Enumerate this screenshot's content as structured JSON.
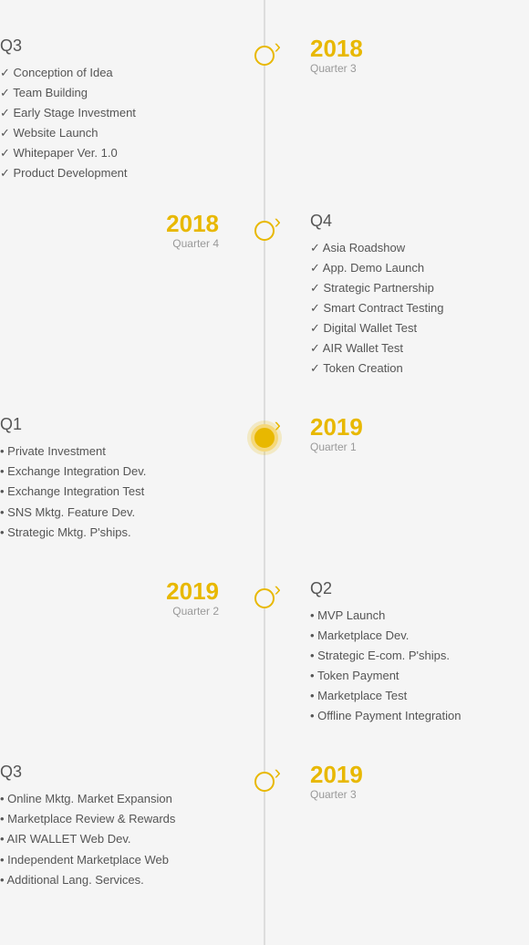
{
  "timeline": {
    "blocks": [
      {
        "id": "q3-2018",
        "side": "left-text",
        "active": false,
        "left": {
          "quarter_title": "Q3",
          "items": [
            "Conception of Idea",
            "Team Building",
            "Early Stage Investment",
            "Website Launch",
            "Whitepaper Ver. 1.0",
            "Product Development"
          ],
          "item_type": "check"
        },
        "right": {
          "year": "2018",
          "quarter": "Quarter 3"
        }
      },
      {
        "id": "q4-2018",
        "side": "right-text",
        "active": false,
        "left": {
          "year": "2018",
          "quarter": "Quarter 4"
        },
        "right": {
          "quarter_title": "Q4",
          "items": [
            "Asia Roadshow",
            "App. Demo Launch",
            "Strategic Partnership",
            "Smart Contract Testing",
            "Digital Wallet Test",
            "AIR Wallet Test",
            "Token Creation"
          ],
          "item_type": "check"
        }
      },
      {
        "id": "q1-2019",
        "side": "left-text",
        "active": true,
        "left": {
          "quarter_title": "Q1",
          "items": [
            "Private Investment",
            "Exchange Integration Dev.",
            "Exchange Integration Test",
            "SNS Mktg. Feature Dev.",
            "Strategic Mktg. P'ships."
          ],
          "item_type": "bullet"
        },
        "right": {
          "year": "2019",
          "quarter": "Quarter 1"
        }
      },
      {
        "id": "q2-2019",
        "side": "right-text",
        "active": false,
        "left": {
          "year": "2019",
          "quarter": "Quarter 2"
        },
        "right": {
          "quarter_title": "Q2",
          "items": [
            "MVP Launch",
            "Marketplace Dev.",
            "Strategic E-com. P'ships.",
            "Token Payment",
            "Marketplace Test",
            "Offline Payment Integration"
          ],
          "item_type": "bullet"
        }
      },
      {
        "id": "q3-2019",
        "side": "left-text",
        "active": false,
        "left": {
          "quarter_title": "Q3",
          "items": [
            "Online Mktg. Market Expansion",
            "Marketplace Review & Rewards",
            "AIR WALLET Web Dev.",
            "Independent Marketplace Web",
            "Additional Lang. Services."
          ],
          "item_type": "bullet"
        },
        "right": {
          "year": "2019",
          "quarter": "Quarter 3"
        }
      }
    ]
  }
}
